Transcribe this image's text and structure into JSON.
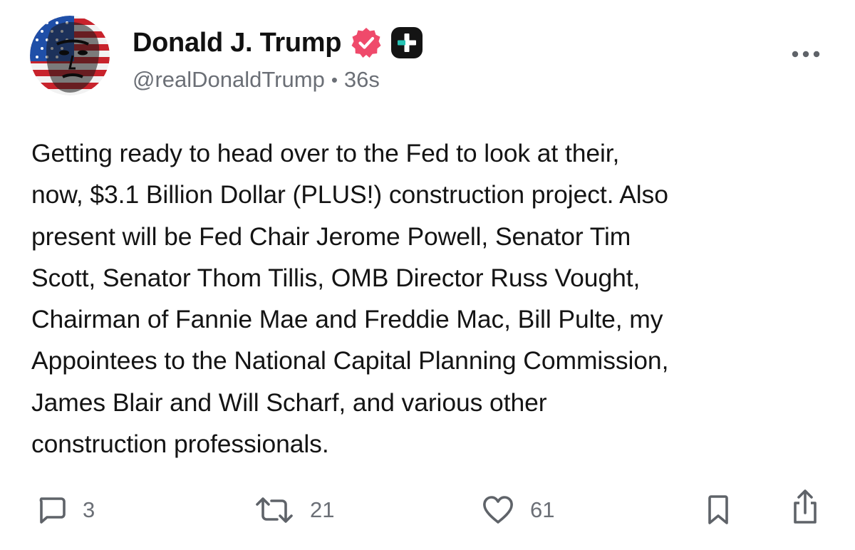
{
  "author": {
    "display_name": "Donald J. Trump",
    "handle": "@realDonaldTrump",
    "separator": "•",
    "time_ago": "36s",
    "avatar_icon": "avatar-flag-portrait",
    "verified_icon": "verified-badge-icon",
    "plus_icon": "plus-subscription-icon"
  },
  "post": {
    "text": "Getting ready to head over to the Fed to look at their,\nnow, $3.1 Billion Dollar (PLUS!) construction project. Also\npresent will be Fed Chair Jerome Powell, Senator Tim\nScott, Senator Thom Tillis, OMB Director Russ Vought,\nChairman of Fannie Mae and Freddie Mac, Bill Pulte, my\nAppointees to the National Capital Planning Commission,\nJames Blair and Will Scharf, and various other\nconstruction professionals."
  },
  "actions": {
    "replies": "3",
    "retruths": "21",
    "likes": "61"
  },
  "colors": {
    "verified": "#ef4a6b",
    "text_primary": "#111111",
    "text_secondary": "#6b6f76",
    "icon": "#5f6369"
  }
}
